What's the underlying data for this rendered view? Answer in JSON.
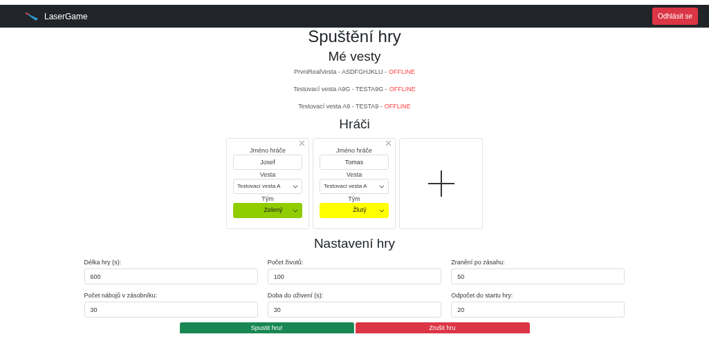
{
  "navbar": {
    "brand": "LaserGame",
    "logout": "Odhlásit se"
  },
  "title": "Spuštění hry",
  "vests_heading": "Mé vesty",
  "vests": [
    {
      "info": "PrvniRealVesta - ASDFGHJKLU -",
      "status": "OFFLINE",
      "online": false
    },
    {
      "info": "Testovací vesta A9G - TESTA9G -",
      "status": "OFFLINE",
      "online": false
    },
    {
      "info": "Testovací vesta A9 - TESTA9 -",
      "status": "OFFLINE",
      "online": false
    }
  ],
  "players_heading": "Hráči",
  "players": [
    {
      "name_label": "Jméno hráče",
      "name": "Josef",
      "vest_label": "Vesta",
      "vest": "Testovací vesta A",
      "team_label": "Tým",
      "team": "Zelený",
      "color": "#8fcc00"
    },
    {
      "name_label": "Jméno hráče",
      "name": "Tomas",
      "vest_label": "Vesta",
      "vest": "Testovací vesta A",
      "team_label": "Tým",
      "team": "Žlutý",
      "color": "#ffff00"
    }
  ],
  "settings_heading": "Nastavení hry",
  "settings": [
    {
      "label": "Délka hry (s):",
      "value": "600"
    },
    {
      "label": "Počet životů:",
      "value": "100"
    },
    {
      "label": "Zranění po zásahu:",
      "value": "50"
    },
    {
      "label": "Počet nábojů v zásobníku:",
      "value": "30"
    },
    {
      "label": "Doba do oživení (s):",
      "value": "30"
    },
    {
      "label": "Odpočet do startu hry:",
      "value": "20"
    }
  ],
  "buttons": [
    {
      "label": "Spustit hru!",
      "kind": "primary"
    },
    {
      "label": "Zrušit hru",
      "kind": "danger"
    }
  ]
}
